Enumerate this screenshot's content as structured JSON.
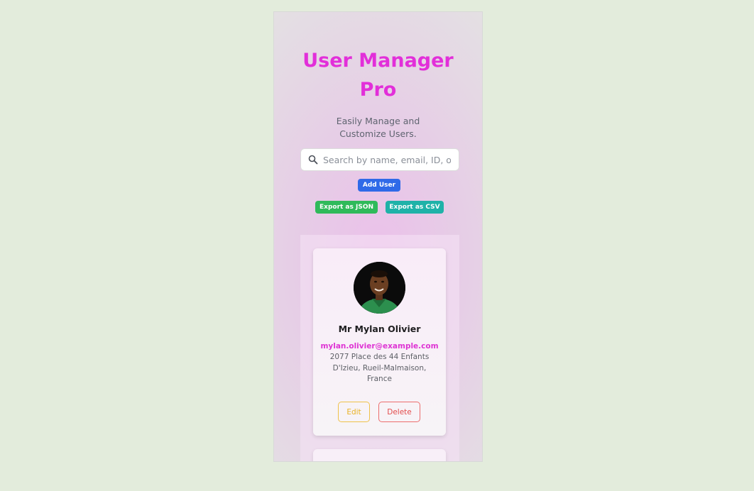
{
  "app": {
    "title": "User Manager Pro",
    "subtitle": "Easily Manage and Customize Users."
  },
  "search": {
    "placeholder": "Search by name, email, ID, or lo",
    "value": ""
  },
  "actions": {
    "add_label": "Add User",
    "export_json_label": "Export as JSON",
    "export_csv_label": "Export as CSV"
  },
  "users": [
    {
      "name": "Mr Mylan Olivier",
      "email": "mylan.olivier@example.com",
      "address": "2077 Place des 44 Enfants D'Izieu, Rueil-Malmaison, France",
      "edit_label": "Edit",
      "delete_label": "Delete"
    }
  ],
  "colors": {
    "title": "#e22fd9",
    "add_button": "#2f6ae8",
    "export_json_button": "#2fba5a",
    "export_csv_button": "#1fb2a8",
    "edit_outline": "#efc24a",
    "delete_outline": "#ec6d6d",
    "email": "#de34d4"
  },
  "icons": {
    "search": "search-icon"
  }
}
